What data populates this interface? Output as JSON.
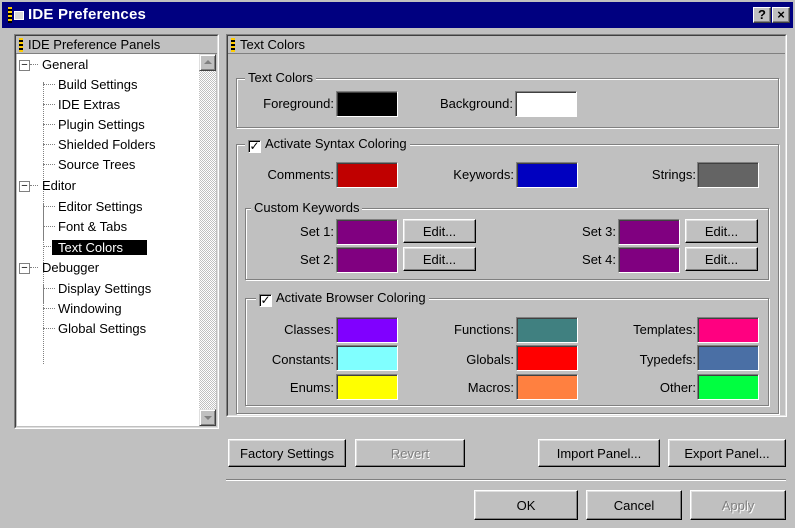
{
  "window": {
    "title": "IDE Preferences",
    "help_label": "?",
    "close_label": "×"
  },
  "left_panel": {
    "header": "IDE Preference Panels",
    "tree": [
      {
        "label": "General",
        "level": 0,
        "expanded": true
      },
      {
        "label": "Build Settings",
        "level": 1
      },
      {
        "label": "IDE Extras",
        "level": 1
      },
      {
        "label": "Plugin Settings",
        "level": 1
      },
      {
        "label": "Shielded Folders",
        "level": 1
      },
      {
        "label": "Source Trees",
        "level": 1
      },
      {
        "label": "Editor",
        "level": 0,
        "expanded": true
      },
      {
        "label": "Editor Settings",
        "level": 1
      },
      {
        "label": "Font & Tabs",
        "level": 1
      },
      {
        "label": "Text Colors",
        "level": 1,
        "selected": true
      },
      {
        "label": "Debugger",
        "level": 0,
        "expanded": true
      },
      {
        "label": "Display Settings",
        "level": 1
      },
      {
        "label": "Windowing",
        "level": 1
      },
      {
        "label": "Global Settings",
        "level": 1
      }
    ]
  },
  "right_panel": {
    "header": "Text Colors",
    "text_colors": {
      "title": "Text Colors",
      "foreground_label": "Foreground:",
      "foreground_color": "#000000",
      "background_label": "Background:",
      "background_color": "#ffffff"
    },
    "syntax": {
      "title": "Activate Syntax Coloring",
      "checked": true,
      "comments_label": "Comments:",
      "comments_color": "#c00000",
      "keywords_label": "Keywords:",
      "keywords_color": "#0000c0",
      "strings_label": "Strings:",
      "strings_color": "#646464",
      "custom": {
        "title": "Custom Keywords",
        "edit_label": "Edit...",
        "sets": [
          {
            "label": "Set 1:",
            "color": "#800080"
          },
          {
            "label": "Set 2:",
            "color": "#800080"
          },
          {
            "label": "Set 3:",
            "color": "#800080"
          },
          {
            "label": "Set 4:",
            "color": "#800080"
          }
        ]
      }
    },
    "browser": {
      "title": "Activate Browser Coloring",
      "checked": true,
      "items": [
        {
          "label": "Classes:",
          "color": "#8000ff"
        },
        {
          "label": "Constants:",
          "color": "#80ffff"
        },
        {
          "label": "Enums:",
          "color": "#ffff00"
        },
        {
          "label": "Functions:",
          "color": "#408080"
        },
        {
          "label": "Globals:",
          "color": "#ff0000"
        },
        {
          "label": "Macros:",
          "color": "#ff8040"
        },
        {
          "label": "Templates:",
          "color": "#ff0080"
        },
        {
          "label": "Typedefs:",
          "color": "#4a6fa5"
        },
        {
          "label": "Other:",
          "color": "#00ff40"
        }
      ]
    }
  },
  "panel_buttons": {
    "factory": "Factory Settings",
    "revert": "Revert",
    "import": "Import Panel...",
    "export": "Export Panel..."
  },
  "dialog_buttons": {
    "ok": "OK",
    "cancel": "Cancel",
    "apply": "Apply"
  }
}
